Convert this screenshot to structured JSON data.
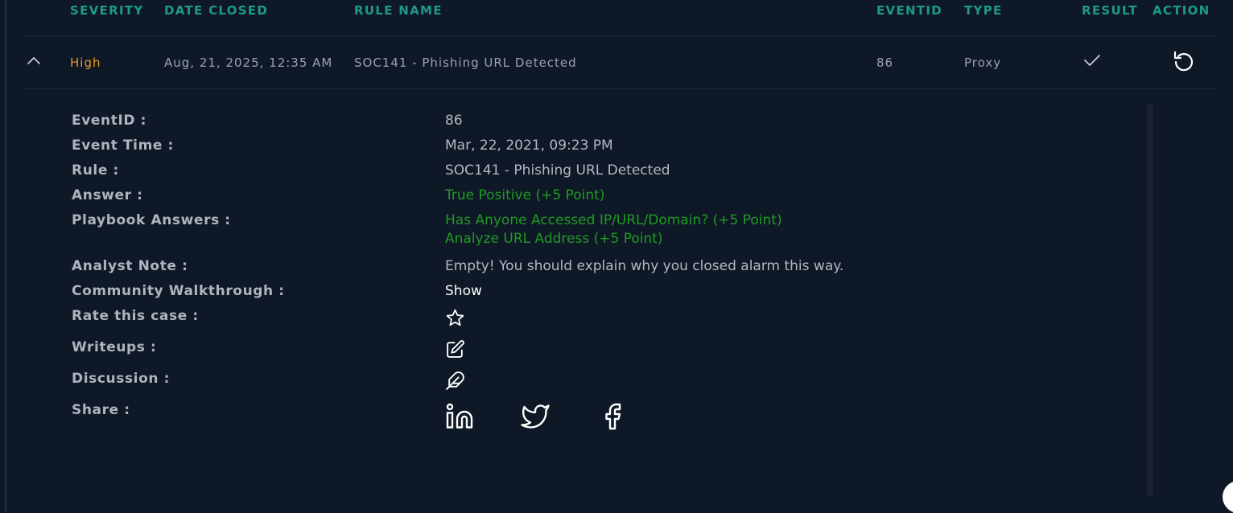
{
  "table": {
    "headers": {
      "severity": "SEVERITY",
      "date_closed": "DATE CLOSED",
      "rule_name": "RULE NAME",
      "eventid": "EVENTID",
      "type": "TYPE",
      "result": "RESULT",
      "action": "ACTION"
    },
    "row": {
      "severity": "High",
      "date_closed": "Aug, 21, 2025, 12:35 AM",
      "rule_name": "SOC141 - Phishing URL Detected",
      "eventid": "86",
      "type": "Proxy",
      "result_icon": "check-icon",
      "action_icon": "undo-icon",
      "expand_icon": "chevron-up-icon"
    }
  },
  "details": {
    "event_id": {
      "label": "EventID :",
      "value": "86"
    },
    "event_time": {
      "label": "Event Time :",
      "value": "Mar, 22, 2021, 09:23 PM"
    },
    "rule": {
      "label": "Rule :",
      "value": "SOC141 - Phishing URL Detected"
    },
    "answer": {
      "label": "Answer :",
      "value": "True Positive (+5 Point)"
    },
    "playbook_answers": {
      "label": "Playbook Answers :",
      "values": [
        "Has Anyone Accessed IP/URL/Domain? (+5 Point)",
        "Analyze URL Address (+5 Point)"
      ]
    },
    "analyst_note": {
      "label": "Analyst Note :",
      "value": "Empty! You should explain why you closed alarm this way."
    },
    "community_walkthrough": {
      "label": "Community Walkthrough :",
      "value": "Show"
    },
    "rate": {
      "label": "Rate this case :",
      "icon": "star-icon"
    },
    "writeups": {
      "label": "Writeups :",
      "icon": "edit-icon"
    },
    "discussion": {
      "label": "Discussion :",
      "icon": "feather-icon"
    },
    "share": {
      "label": "Share :",
      "icons": [
        "linkedin-icon",
        "twitter-icon",
        "facebook-icon"
      ]
    }
  },
  "colors": {
    "background": "#0f1826",
    "header_teal": "#1d9a8a",
    "severity_high": "#e7971f",
    "answer_green": "#1f9b25"
  }
}
